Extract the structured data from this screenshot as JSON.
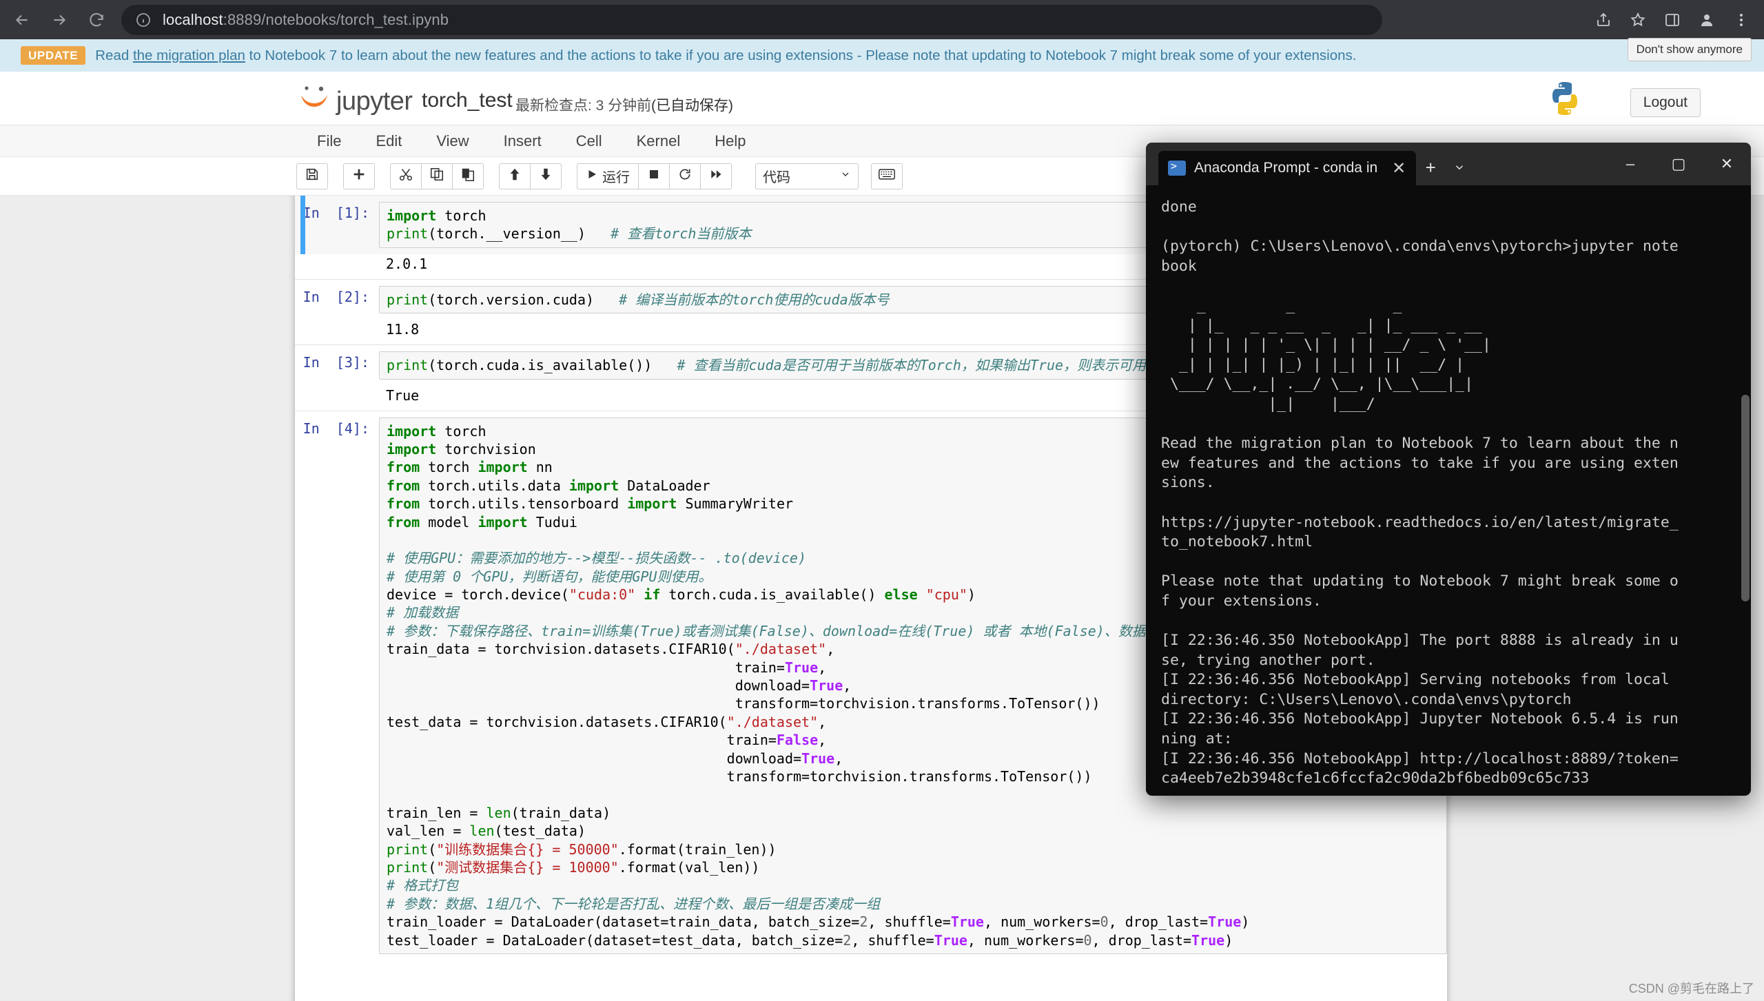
{
  "browser": {
    "url_host": "localhost",
    "url_rest": ":8889/notebooks/torch_test.ipynb",
    "back_icon": "back-arrow-icon",
    "forward_icon": "forward-arrow-icon",
    "reload_icon": "reload-icon",
    "info_icon": "info-circle-icon"
  },
  "banner": {
    "badge": "UPDATE",
    "text_before": "Read ",
    "link": "the migration plan",
    "text_after": " to Notebook 7 to learn about the new features and the actions to take if you are using extensions - Please note that updating to Notebook 7 might break some of your extensions.",
    "dismiss": "Don't show anymore"
  },
  "jupyter": {
    "logo_text": "jupyter",
    "notebook_name": "torch_test",
    "checkpoint": "最新检查点: 3 分钟前",
    "autosave": "(已自动保存)",
    "logout": "Logout",
    "menu": [
      "File",
      "Edit",
      "View",
      "Insert",
      "Cell",
      "Kernel",
      "Help"
    ],
    "toolbar": {
      "save": "save-icon",
      "add": "add-cell-icon",
      "cut": "cut-icon",
      "copy": "copy-icon",
      "paste": "paste-icon",
      "move_up": "move-up-icon",
      "move_down": "move-down-icon",
      "run_label": "运行",
      "stop": "stop-icon",
      "restart": "restart-icon",
      "fastforward": "restart-run-all-icon",
      "celltype": "代码",
      "keyboard": "keyboard-icon"
    }
  },
  "cells": [
    {
      "prompt": "In  [1]:",
      "selected": true,
      "code_html": "<span class=\"k\">import</span> torch\n<span class=\"b\">print</span>(torch.__version__)   <span class=\"c\"># 查看torch当前版本</span>",
      "output": "2.0.1"
    },
    {
      "prompt": "In  [2]:",
      "selected": false,
      "code_html": "<span class=\"b\">print</span>(torch.version.cuda)   <span class=\"c\"># 编译当前版本的torch使用的cuda版本号</span>",
      "output": "11.8"
    },
    {
      "prompt": "In  [3]:",
      "selected": false,
      "code_html": "<span class=\"b\">print</span>(torch.cuda.is_available())   <span class=\"c\"># 查看当前cuda是否可用于当前版本的Torch，如果输出True，则表示可用</span>",
      "output": "True"
    },
    {
      "prompt": "In  [4]:",
      "selected": false,
      "code_html": "<span class=\"k\">import</span> torch\n<span class=\"k\">import</span> torchvision\n<span class=\"k\">from</span> torch <span class=\"k\">import</span> nn\n<span class=\"k\">from</span> torch.utils.data <span class=\"k\">import</span> DataLoader\n<span class=\"k\">from</span> torch.utils.tensorboard <span class=\"k\">import</span> SummaryWriter\n<span class=\"k\">from</span> model <span class=\"k\">import</span> Tudui\n\n<span class=\"c\"># 使用GPU：需要添加的地方--&gt;模型--损失函数-- .to(device)</span>\n<span class=\"c\"># 使用第 0 个GPU，判断语句，能使用GPU则使用。</span>\ndevice = torch.device(<span class=\"s\">\"cuda:0\"</span> <span class=\"k\">if</span> torch.cuda.is_available() <span class=\"k\">else</span> <span class=\"s\">\"cpu\"</span>)\n<span class=\"c\"># 加载数据</span>\n<span class=\"c\"># 参数：下载保存路径、train=训练集(True)或者测试集(False)、download=在线(True) 或者 本地(False)、数据</span>\ntrain_data = torchvision.datasets.CIFAR10(<span class=\"s\">\"./dataset\"</span>,\n                                          train=<span class=\"kw\">True</span>,\n                                          download=<span class=\"kw\">True</span>,\n                                          transform=torchvision.transforms.ToTensor())\ntest_data = torchvision.datasets.CIFAR10(<span class=\"s\">\"./dataset\"</span>,\n                                         train=<span class=\"kw\">False</span>,\n                                         download=<span class=\"kw\">True</span>,\n                                         transform=torchvision.transforms.ToTensor())\n\ntrain_len = <span class=\"b\">len</span>(train_data)\nval_len = <span class=\"b\">len</span>(test_data)\n<span class=\"b\">print</span>(<span class=\"s\">\"训练数据集合{} = 50000\"</span>.format(train_len))\n<span class=\"b\">print</span>(<span class=\"s\">\"测试数据集合{} = 10000\"</span>.format(val_len))\n<span class=\"c\"># 格式打包</span>\n<span class=\"c\"># 参数：数据、1组几个、下一轮轮是否打乱、进程个数、最后一组是否凑成一组</span>\ntrain_loader = DataLoader(dataset=train_data, batch_size=<span class=\"n\">2</span>, shuffle=<span class=\"kw\">True</span>, num_workers=<span class=\"n\">0</span>, drop_last=<span class=\"kw\">True</span>)\ntest_loader = DataLoader(dataset=test_data, batch_size=<span class=\"n\">2</span>, shuffle=<span class=\"kw\">True</span>, num_workers=<span class=\"n\">0</span>, drop_last=<span class=\"kw\">True</span>)",
      "output": null
    }
  ],
  "terminal": {
    "tab_title": "Anaconda Prompt - conda  in",
    "close_icon": "close-icon",
    "new_tab_icon": "new-tab-icon",
    "dropdown_icon": "chevron-down-icon",
    "minimize": "–",
    "maximize": "▢",
    "close": "✕",
    "content": "done\n\n(pytorch) C:\\Users\\Lenovo\\.conda\\envs\\pytorch>jupyter note\nbook\n\n    _         _           _\n   | |_   _ _ __  _   _| |_ ___ _ __\n   | | | | | '_ \\| | | | __/ _ \\ '__|\n  _| | |_| | |_) | |_| | ||  __/ |\n \\___/ \\__,_| .__/ \\__, |\\__\\___|_|\n            |_|    |___/\n\nRead the migration plan to Notebook 7 to learn about the n\new features and the actions to take if you are using exten\nsions.\n\nhttps://jupyter-notebook.readthedocs.io/en/latest/migrate_\nto_notebook7.html\n\nPlease note that updating to Notebook 7 might break some o\nf your extensions.\n\n[I 22:36:46.350 NotebookApp] The port 8888 is already in u\nse, trying another port.\n[I 22:36:46.356 NotebookApp] Serving notebooks from local\ndirectory: C:\\Users\\Lenovo\\.conda\\envs\\pytorch\n[I 22:36:46.356 NotebookApp] Jupyter Notebook 6.5.4 is run\nning at:\n[I 22:36:46.356 NotebookApp] http://localhost:8889/?token=\nca4eeb7e2b3948cfe1c6fccfa2c90da2bf6bedb09c65c733"
  },
  "watermark": "CSDN @剪毛在路上了"
}
